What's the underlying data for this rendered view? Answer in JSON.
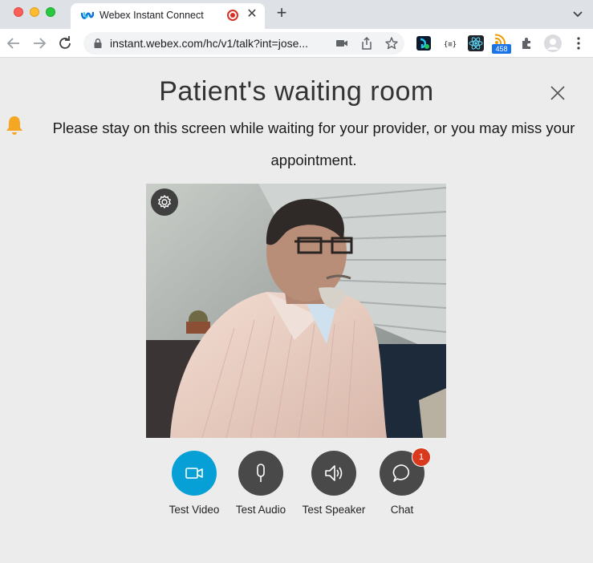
{
  "browser": {
    "tab": {
      "title": "Webex Instant Connect"
    },
    "url": "instant.webex.com/hc/v1/talk?int=jose...",
    "extensions": {
      "badge_count": "458"
    }
  },
  "page": {
    "title": "Patient's waiting room",
    "notice": "Please stay on this screen while waiting for your provider, or you may miss your appointment."
  },
  "controls": [
    {
      "label": "Test Video"
    },
    {
      "label": "Test Audio"
    },
    {
      "label": "Test Speaker"
    },
    {
      "label": "Chat",
      "badge": "1"
    }
  ],
  "colors": {
    "accent": "#07a0d6",
    "control_bg": "#494949",
    "badge": "#d93a1e",
    "bell": "#f5a623"
  }
}
